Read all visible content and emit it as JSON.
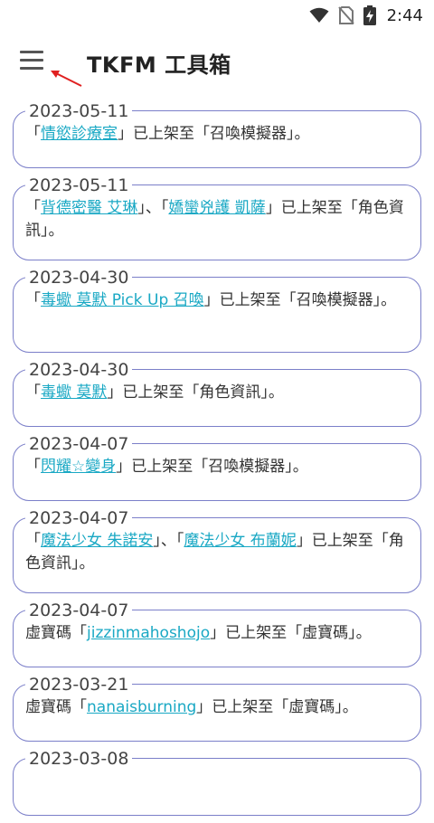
{
  "status": {
    "time": "2:44"
  },
  "app": {
    "title": "TKFM 工具箱"
  },
  "news": [
    {
      "date": "2023-05-11",
      "parts": [
        [
          "t",
          "「"
        ],
        [
          "a",
          "情慾診療室"
        ],
        [
          "t",
          "」已上架至「召喚模擬器」。"
        ]
      ]
    },
    {
      "date": "2023-05-11",
      "parts": [
        [
          "t",
          "「"
        ],
        [
          "a",
          "背德密醫 艾琳"
        ],
        [
          "t",
          "」、「"
        ],
        [
          "a",
          "嬌蠻兇護 凱薩"
        ],
        [
          "t",
          "」已上架至「角色資訊」。"
        ]
      ]
    },
    {
      "date": "2023-04-30",
      "parts": [
        [
          "t",
          "「"
        ],
        [
          "a",
          "毒蠍 莫默 Pick Up 召喚"
        ],
        [
          "t",
          "」已上架至「召喚模擬器」。"
        ]
      ]
    },
    {
      "date": "2023-04-30",
      "parts": [
        [
          "t",
          "「"
        ],
        [
          "a",
          "毒蠍 莫默"
        ],
        [
          "t",
          "」已上架至「角色資訊」。"
        ]
      ]
    },
    {
      "date": "2023-04-07",
      "parts": [
        [
          "t",
          "「"
        ],
        [
          "a",
          "閃耀☆變身"
        ],
        [
          "t",
          "」已上架至「召喚模擬器」。"
        ]
      ]
    },
    {
      "date": "2023-04-07",
      "parts": [
        [
          "t",
          "「"
        ],
        [
          "a",
          "魔法少女 朱諾安"
        ],
        [
          "t",
          "」、「"
        ],
        [
          "a",
          "魔法少女 布蘭妮"
        ],
        [
          "t",
          "」已上架至「角色資訊」。"
        ]
      ]
    },
    {
      "date": "2023-04-07",
      "parts": [
        [
          "t",
          "虛寶碼「"
        ],
        [
          "a",
          "jizzinmahoshojo"
        ],
        [
          "t",
          "」已上架至「虛寶碼」。"
        ]
      ]
    },
    {
      "date": "2023-03-21",
      "parts": [
        [
          "t",
          "虛寶碼「"
        ],
        [
          "a",
          "nanaisburning"
        ],
        [
          "t",
          "」已上架至「虛寶碼」。"
        ]
      ]
    },
    {
      "date": "2023-03-08",
      "parts": []
    }
  ],
  "colors": {
    "accent": "#7b7fc9",
    "link": "#19a8c4",
    "annotation": "#e02020"
  },
  "icons": [
    "wifi-icon",
    "no-sim-icon",
    "battery-charging-icon",
    "menu-icon"
  ]
}
